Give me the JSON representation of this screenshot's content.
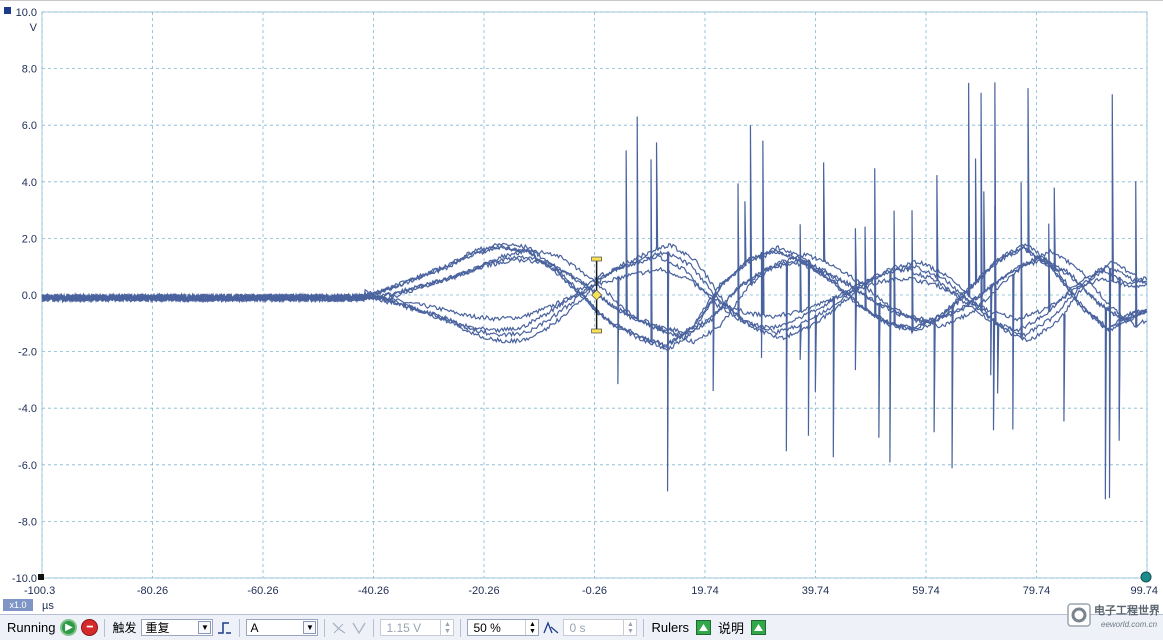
{
  "scope": {
    "y_ticks": [
      "10.0",
      "8.0",
      "6.0",
      "4.0",
      "2.0",
      "0.0",
      "-2.0",
      "-4.0",
      "-6.0",
      "-8.0",
      "-10.0"
    ],
    "y_unit": "V",
    "x_ticks": [
      "-100.3",
      "-80.26",
      "-60.26",
      "-40.26",
      "-20.26",
      "-0.26",
      "19.74",
      "39.74",
      "59.74",
      "79.74",
      "99.74"
    ],
    "x_unit": "µs",
    "zoom": "x1.0",
    "trace_color": "#4a639e",
    "grid_color": "#7fb8d4",
    "trigger_marker_color": "#f3e25a"
  },
  "chart_data": {
    "type": "line",
    "xlabel": "µs",
    "ylabel": "V",
    "xlim": [
      -100.3,
      99.74
    ],
    "ylim": [
      -10.0,
      10.0
    ],
    "grid": true,
    "series": [
      {
        "x": [
          -100.3,
          -60.26,
          -40.26,
          -35,
          -30,
          -25,
          -20.26,
          -15,
          -10,
          -5,
          -0.26,
          2,
          5,
          10,
          15,
          19.74,
          25,
          30,
          35,
          39.74,
          45,
          50,
          55,
          59.74,
          65,
          70,
          75,
          79.74,
          85,
          90,
          95,
          99.74
        ],
        "y": [
          -0.1,
          -0.1,
          -0.1,
          0.2,
          0.5,
          0.8,
          1.2,
          1.4,
          1.3,
          0.7,
          0.0,
          -0.4,
          -0.8,
          -1.2,
          -1.5,
          -1.0,
          0.3,
          1.0,
          1.3,
          1.0,
          0.4,
          -0.3,
          -0.8,
          -1.0,
          -0.6,
          0.2,
          1.0,
          1.4,
          0.8,
          -0.3,
          -1.0,
          -0.5
        ]
      }
    ]
  },
  "toolbar": {
    "status": "Running",
    "trigger_label": "触发",
    "trigger_mode": "重复",
    "trigger_source": "A",
    "threshold": "1.15 V",
    "pretrigger": "50 %",
    "delay": "0 s",
    "rulers_label": "Rulers",
    "notes_label": "说明"
  },
  "logo": {
    "text_main": "电子工程世界",
    "text_url": "eeworld.com.cn"
  }
}
